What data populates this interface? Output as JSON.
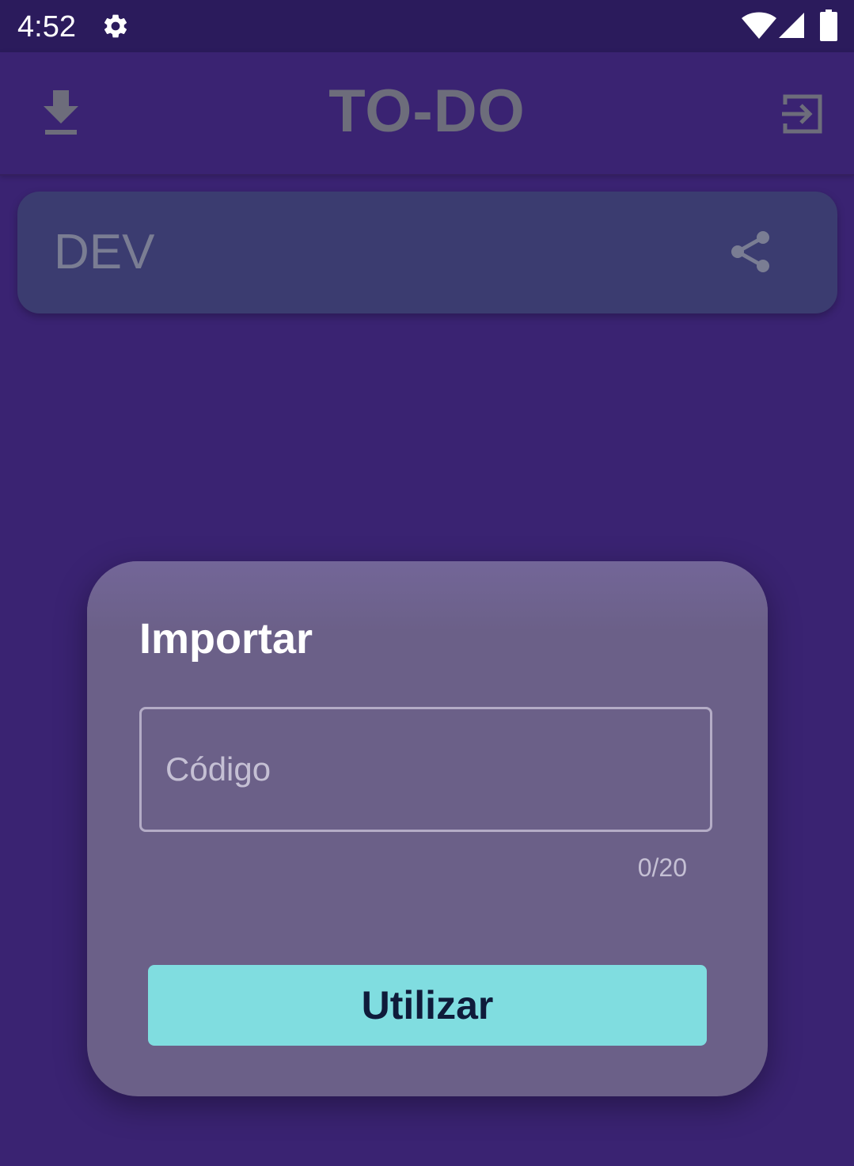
{
  "status_bar": {
    "time": "4:52",
    "icons": [
      "gear-icon",
      "wifi-icon",
      "signal-icon",
      "battery-icon"
    ]
  },
  "app_bar": {
    "title": "TO-DO",
    "left_action_icon": "download-icon",
    "right_action_icon": "exit-icon"
  },
  "list_card": {
    "name": "DEV",
    "action_icon": "share-icon"
  },
  "import_dialog": {
    "title": "Importar",
    "code_field": {
      "value": "",
      "placeholder": "Código",
      "counter": "0/20"
    },
    "submit_label": "Utilizar"
  },
  "colors": {
    "status_bar_bg": "#2b1b5c",
    "background": "#3a2372",
    "card_bg": "#3b3c70",
    "dialog_bg": "#6b6088",
    "button_bg": "#80dde0",
    "title_text": "#6d6d7b"
  }
}
